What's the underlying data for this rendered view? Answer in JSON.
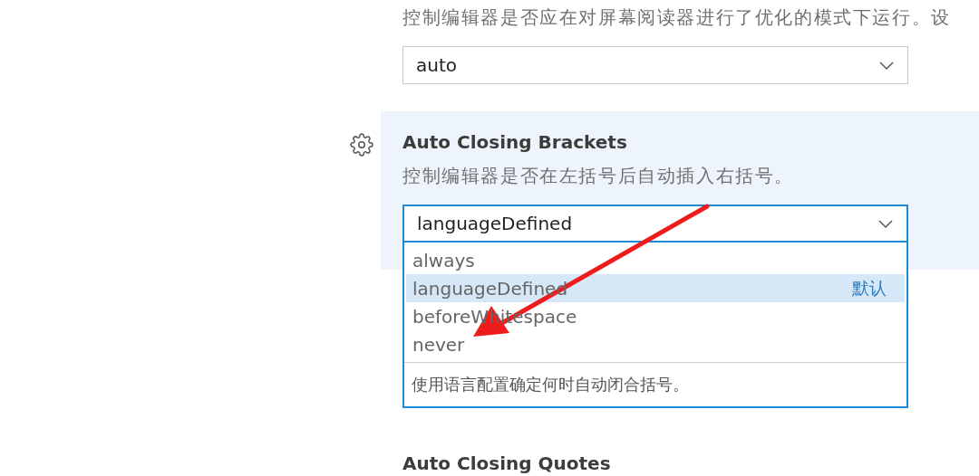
{
  "settings": [
    {
      "kind": "plain",
      "description": "控制编辑器是否应在对屏幕阅读器进行了优化的模式下运行。设",
      "select": {
        "value": "auto",
        "expanded": false
      }
    },
    {
      "kind": "focused",
      "title": "Auto Closing Brackets",
      "description": "控制编辑器是否在左括号后自动插入右括号。",
      "select": {
        "value": "languageDefined",
        "expanded": true,
        "options": [
          {
            "label": "always",
            "selected": false
          },
          {
            "label": "languageDefined",
            "selected": true,
            "badge": "默认"
          },
          {
            "label": "beforeWhitespace",
            "selected": false
          },
          {
            "label": "never",
            "selected": false
          }
        ],
        "option_description": "使用语言配置确定何时自动闭合括号。"
      }
    },
    {
      "kind": "plain",
      "title": "Auto Closing Quotes"
    }
  ],
  "annotation": {
    "kind": "arrow"
  }
}
